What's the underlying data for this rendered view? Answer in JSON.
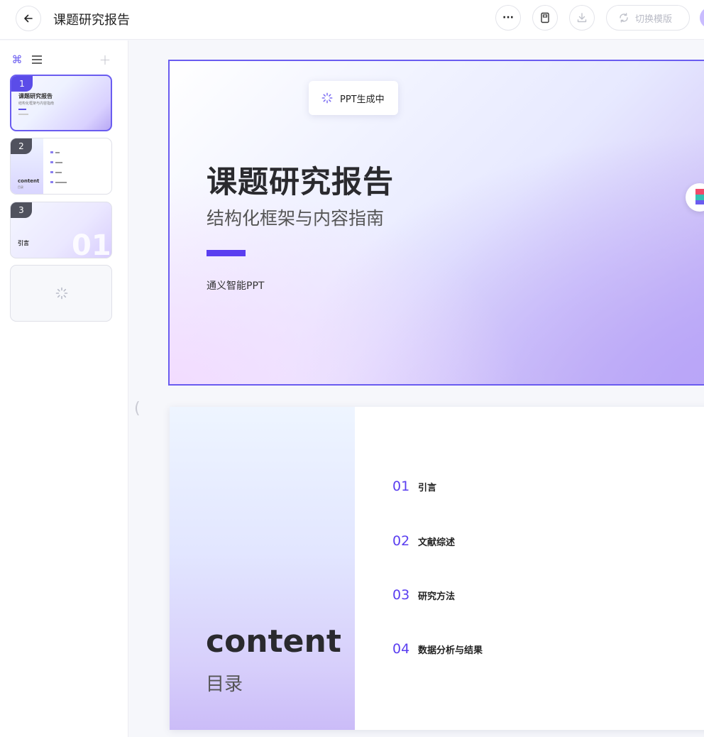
{
  "header": {
    "title": "课题研究报告",
    "switch_template_label": "切换模版",
    "more_label": "···"
  },
  "sidebar": {
    "thumbs": [
      {
        "num": "1",
        "title": "课题研究报告",
        "subtitle": "结构化框架与内容指南"
      },
      {
        "num": "2",
        "title": "content",
        "subtitle": "目录"
      },
      {
        "num": "3",
        "title": "引言",
        "big": "01"
      }
    ]
  },
  "slide1": {
    "status": "PPT生成中",
    "title": "课题研究报告",
    "subtitle": "结构化框架与内容指南",
    "author": "通义智能PPT"
  },
  "slide2": {
    "heading": "content",
    "subheading": "目录",
    "items": [
      {
        "num": "01",
        "label": "引言"
      },
      {
        "num": "02",
        "label": "文献综述"
      },
      {
        "num": "03",
        "label": "研究方法"
      },
      {
        "num": "04",
        "label": "数据分析与结果"
      }
    ]
  },
  "colors": {
    "accent": "#5a3ef0",
    "accent_light": "#6a5cf0"
  }
}
